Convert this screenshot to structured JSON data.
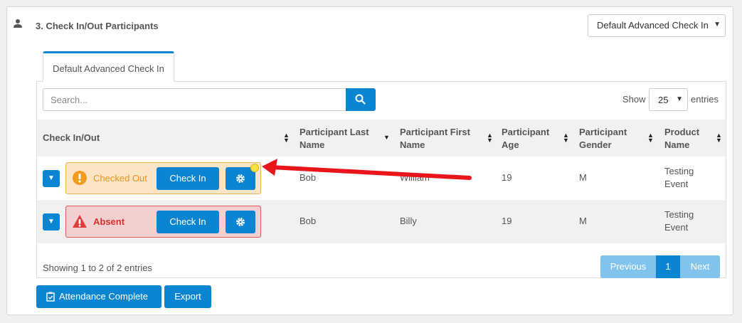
{
  "section": {
    "title": "3. Check In/Out Participants",
    "profile_select": "Default Advanced Check In"
  },
  "tab": {
    "label": "Default Advanced Check In"
  },
  "toolbar": {
    "search_placeholder": "Search...",
    "show_label": "Show",
    "page_size": "25",
    "entries_label": "entries"
  },
  "table": {
    "columns": [
      "Check In/Out",
      "Participant Last Name",
      "Participant First Name",
      "Participant Age",
      "Participant Gender",
      "Product Name"
    ],
    "rows": [
      {
        "status": "Checked Out",
        "action": "Check In",
        "last_name": "Bob",
        "first_name": "William",
        "age": "19",
        "gender": "M",
        "product": "Testing Event"
      },
      {
        "status": "Absent",
        "action": "Check In",
        "last_name": "Bob",
        "first_name": "Billy",
        "age": "19",
        "gender": "M",
        "product": "Testing Event"
      }
    ]
  },
  "footer": {
    "info": "Showing 1 to 2 of 2 entries",
    "previous": "Previous",
    "page": "1",
    "next": "Next"
  },
  "actions": {
    "attendance_complete": "Attendance Complete",
    "export": "Export"
  },
  "colors": {
    "primary": "#0b85d1",
    "checked_out": "#e8941f",
    "absent": "#d8302f",
    "annotation_arrow": "#e8151b"
  },
  "icons": [
    "person-icon",
    "search-icon",
    "gear-icon",
    "warning-circle-icon",
    "warning-triangle-icon",
    "clipboard-check-icon",
    "caret-down-icon",
    "sort-icon"
  ]
}
